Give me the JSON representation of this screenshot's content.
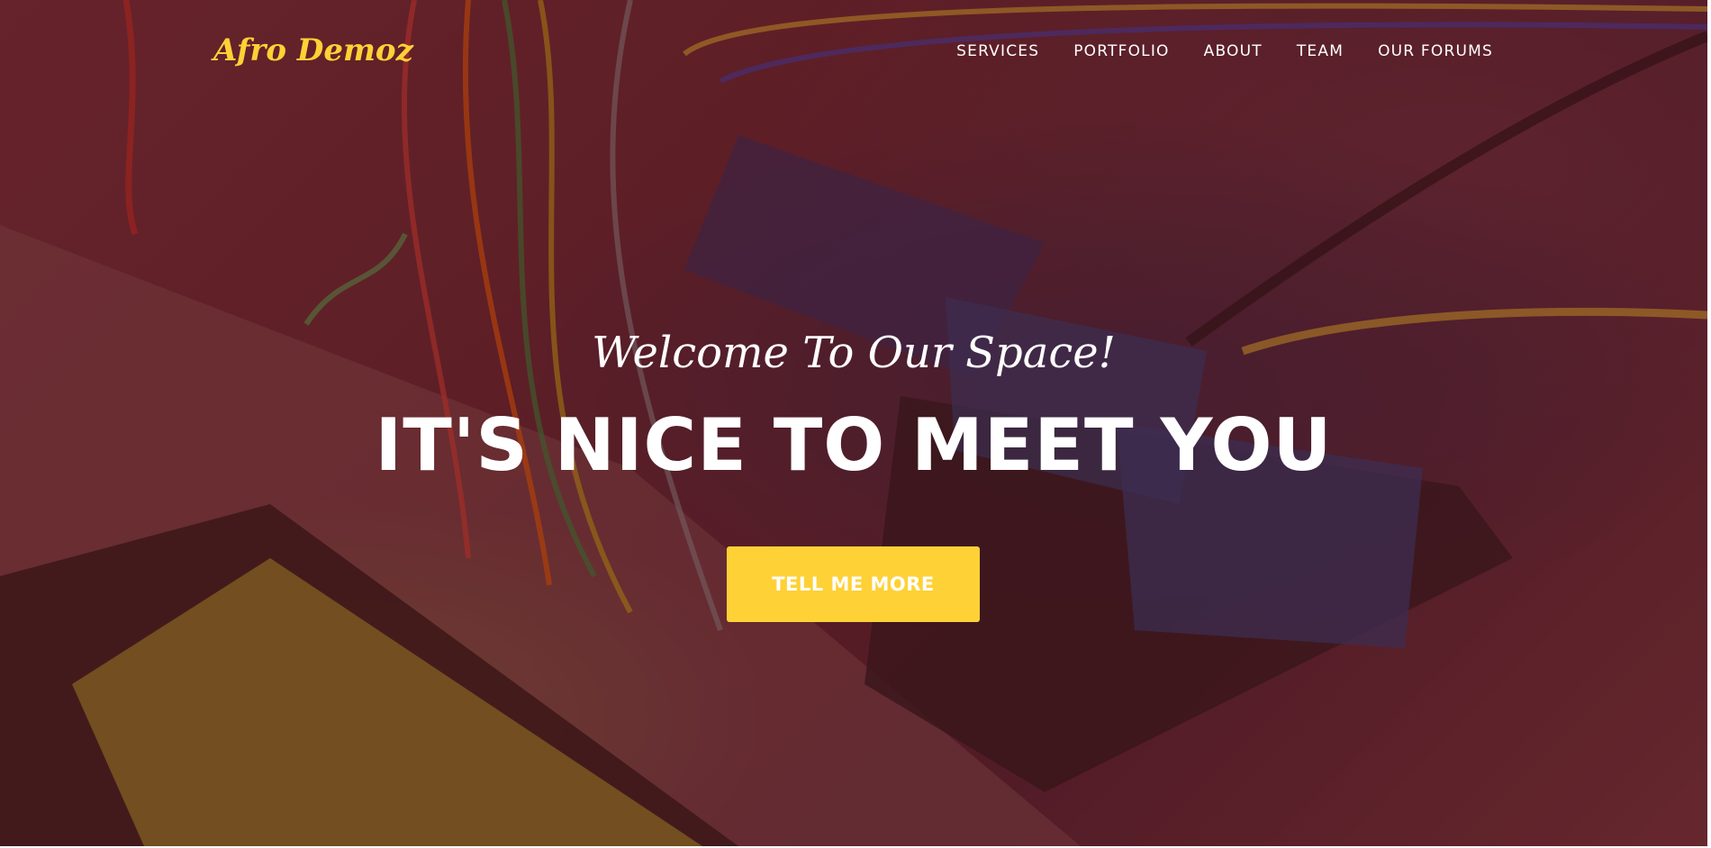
{
  "brand": {
    "name": "Afro Demoz"
  },
  "nav": {
    "items": [
      {
        "label": "SERVICES"
      },
      {
        "label": "PORTFOLIO"
      },
      {
        "label": "ABOUT"
      },
      {
        "label": "TEAM"
      },
      {
        "label": "OUR FORUMS"
      }
    ]
  },
  "hero": {
    "subheading": "Welcome To Our Space!",
    "heading": "IT'S NICE TO MEET YOU",
    "cta_label": "TELL ME MORE",
    "background_image": "electronics-breadboard-arduino-photo"
  },
  "colors": {
    "accent": "#fed136",
    "overlay": "#601822",
    "text": "#ffffff"
  }
}
